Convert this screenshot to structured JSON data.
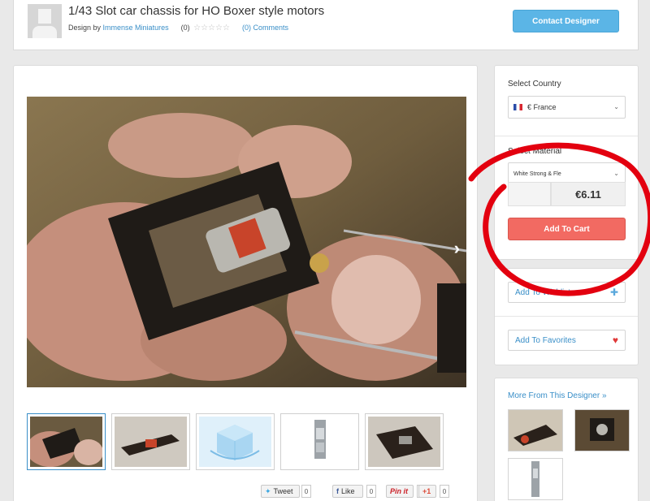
{
  "header": {
    "title": "1/43 Slot car chassis for HO Boxer style motors",
    "design_by_label": "Design by",
    "designer": "Immense Miniatures",
    "rating_count": "(0)",
    "stars": "☆☆☆☆☆",
    "comments": "(0) Comments",
    "contact_label": "Contact Designer"
  },
  "gallery": {
    "next_glyph": "›"
  },
  "social": {
    "tweet": "Tweet",
    "tweet_count": "0",
    "like": "Like",
    "like_count": "0",
    "pin": "Pin it",
    "pin_count": "0",
    "gplus": "+1",
    "gplus_count": "0"
  },
  "purchase": {
    "country_label": "Select Country",
    "country_value": "€ France",
    "material_label": "Select Material",
    "material_value": "White Strong & Fle",
    "price": "€6.11",
    "add_to_cart": "Add To Cart"
  },
  "actions": {
    "wishlist": "Add To Wishlist",
    "favorites": "Add To Favorites"
  },
  "more": {
    "link": "More From This Designer »"
  },
  "colors": {
    "accent": "#3a8fc8",
    "contact_button": "#5bb5e6",
    "cart_button": "#f26a62",
    "annotation": "#e3000f"
  }
}
